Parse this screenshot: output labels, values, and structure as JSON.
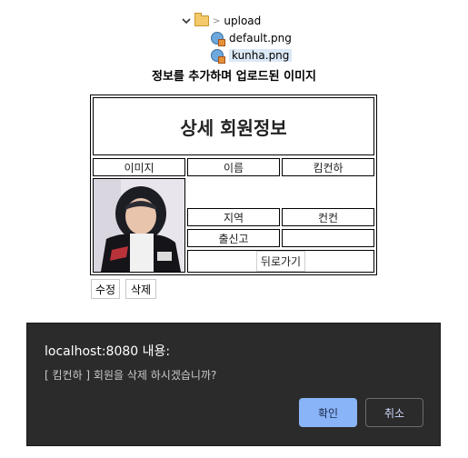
{
  "file_tree": {
    "folder_name": "upload",
    "files": [
      {
        "name": "default.png",
        "selected": false
      },
      {
        "name": "kunha.png",
        "selected": true
      }
    ]
  },
  "page": {
    "heading": "정보를 추가하며 업로드된 이미지"
  },
  "member_detail": {
    "title": "상세 회원정보",
    "image_label": "이미지",
    "name_label": "이름",
    "name_value": "킴컨하",
    "region_label": "지역",
    "region_value": "컨컨",
    "origin_label": "출신고",
    "origin_value": "",
    "back_label": "뒤로가기"
  },
  "actions": {
    "edit_label": "수정",
    "delete_label": "삭제"
  },
  "dialog": {
    "host": "localhost:8080 내용:",
    "message": "[ 킴컨하 ] 회원을 삭제 하시겠습니까?",
    "ok_label": "확인",
    "cancel_label": "취소",
    "ok_color": "#8ab4f8"
  }
}
